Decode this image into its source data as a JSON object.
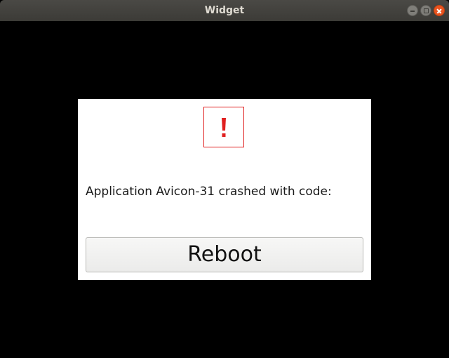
{
  "window": {
    "title": "Widget"
  },
  "dialog": {
    "icon": "exclamation-icon",
    "message": "Application Avicon-31 crashed with code:",
    "reboot_label": "Reboot"
  },
  "colors": {
    "titlebar": "#3c3b37",
    "close_button": "#e95420",
    "warning": "#e02020",
    "background": "#000000",
    "dialog": "#ffffff"
  }
}
